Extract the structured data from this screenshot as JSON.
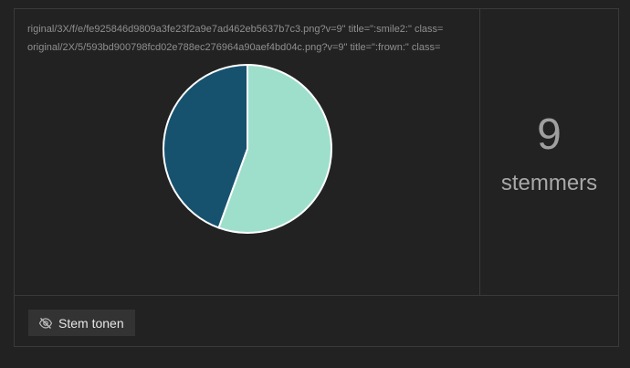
{
  "poll": {
    "raw_lines": [
      "riginal/3X/f/e/fe925846d9809a3fe23f2a9e7ad462eb5637b7c3.png?v=9\" title=\":smile2:\" class=",
      "original/2X/5/593bd900798fcd02e788ec276964a90aef4bd04c.png?v=9\" title=\":frown:\" class="
    ],
    "voters": {
      "count": "9",
      "label": "stemmers"
    },
    "toggle_button": {
      "label": "Stem tonen",
      "icon": "eye-slash-icon"
    }
  },
  "chart_data": {
    "type": "pie",
    "slices": [
      {
        "value": 5,
        "color": "#9edfcc"
      },
      {
        "value": 4,
        "color": "#16526e"
      }
    ],
    "start_angle_deg": 0,
    "stroke_color": "#ffffff"
  }
}
